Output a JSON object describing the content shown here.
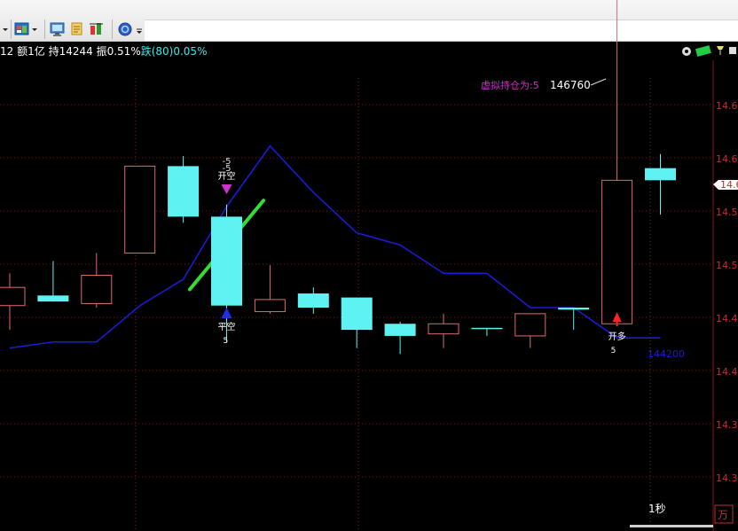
{
  "info": {
    "prefix": "12",
    "amount": "额1亿",
    "hold": "持14244",
    "amplitude": "振0.51%",
    "fall": "跌(80)0.05%"
  },
  "colors": {
    "up": "#e06a6a",
    "down": "#5ff2f2",
    "ma_line": "#1b1bd6",
    "grid": "#8a1515",
    "axis_text": "#c03030",
    "magenta": "#cc33cc",
    "green": "#33dd33"
  },
  "annotations": {
    "virtual_position": "虚拟持仓为:5",
    "peak_value": "146760",
    "ma_end_value": "144200",
    "open_short_top": "-5",
    "open_short_mid": "-5",
    "open_short_label": "开空",
    "close_short_label": "平空",
    "close_short_qty": "5",
    "open_long_label": "开多",
    "open_long_qty": "5",
    "period": "1秒",
    "corner_char": "万"
  },
  "chart_data": {
    "type": "candlestick",
    "y_ticks": [
      "14.6",
      "14.6",
      "14.5",
      "14.5",
      "14.4",
      "14.4",
      "14.3",
      "14.3"
    ],
    "current_price_tag": "14.6",
    "candles": [
      {
        "open": 144.35,
        "close": 144.26,
        "high": 144.42,
        "low": 144.14,
        "dir": "up"
      },
      {
        "open": 144.28,
        "close": 144.31,
        "high": 144.48,
        "low": 144.28,
        "dir": "down"
      },
      {
        "open": 144.27,
        "close": 144.41,
        "high": 144.52,
        "low": 144.25,
        "dir": "up"
      },
      {
        "open": 144.52,
        "close": 144.95,
        "high": 144.95,
        "low": 144.52,
        "dir": "up"
      },
      {
        "open": 144.95,
        "close": 144.7,
        "high": 145.0,
        "low": 144.67,
        "dir": "down"
      },
      {
        "open": 144.7,
        "close": 144.26,
        "high": 144.76,
        "low": 144.08,
        "dir": "down"
      },
      {
        "open": 144.23,
        "close": 144.29,
        "high": 144.46,
        "low": 144.22,
        "dir": "up"
      },
      {
        "open": 144.32,
        "close": 144.25,
        "high": 144.35,
        "low": 144.22,
        "dir": "down"
      },
      {
        "open": 144.3,
        "close": 144.14,
        "high": 144.3,
        "low": 144.05,
        "dir": "down"
      },
      {
        "open": 144.17,
        "close": 144.11,
        "high": 144.18,
        "low": 144.02,
        "dir": "down"
      },
      {
        "open": 144.12,
        "close": 144.17,
        "high": 144.22,
        "low": 144.05,
        "dir": "up"
      },
      {
        "open": 144.15,
        "close": 144.15,
        "high": 144.15,
        "low": 144.11,
        "dir": "down"
      },
      {
        "open": 144.11,
        "close": 144.22,
        "high": 144.22,
        "low": 144.05,
        "dir": "up"
      },
      {
        "open": 144.25,
        "close": 144.24,
        "high": 144.25,
        "low": 144.14,
        "dir": "down"
      },
      {
        "open": 144.17,
        "close": 144.88,
        "high": 146.76,
        "low": 144.17,
        "dir": "up"
      },
      {
        "open": 144.94,
        "close": 144.88,
        "high": 145.01,
        "low": 144.71,
        "dir": "down"
      }
    ],
    "ma_line": [
      144.05,
      144.08,
      144.08,
      144.26,
      144.39,
      144.75,
      145.05,
      144.82,
      144.62,
      144.56,
      144.42,
      144.42,
      144.25,
      144.25,
      144.1,
      144.1
    ],
    "trend_segment": {
      "from_index": 4.15,
      "from_value": 144.34,
      "to_index": 5.85,
      "to_value": 144.78
    }
  }
}
